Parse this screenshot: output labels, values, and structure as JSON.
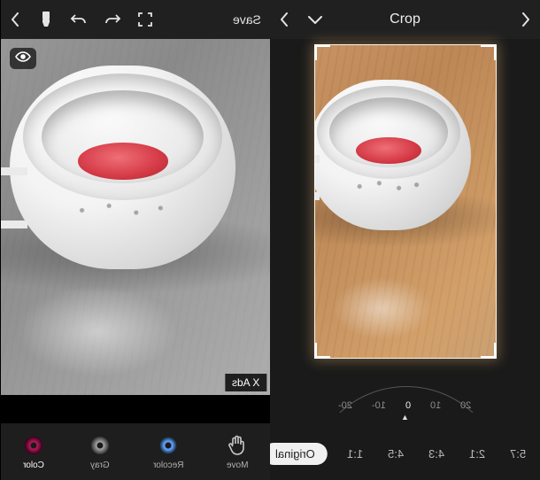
{
  "left": {
    "toolbar": {
      "save": "Save",
      "icons": {
        "fullscreen": "fullscreen-icon",
        "undo": "undo-icon",
        "redo": "redo-icon",
        "brush": "brush-icon",
        "forward": "chevron-right-icon"
      }
    },
    "overlay": {
      "ads": "X Ads",
      "eye": "eye-icon"
    },
    "tools": [
      {
        "key": "move",
        "label": "Move",
        "selected": false
      },
      {
        "key": "recolor",
        "label": "Recolor",
        "selected": false
      },
      {
        "key": "gray",
        "label": "Gray",
        "selected": false
      },
      {
        "key": "color",
        "label": "Color",
        "selected": true
      }
    ]
  },
  "right": {
    "title": "Crop",
    "toolbar": {
      "back": "chevron-left-icon",
      "dropdown": "chevron-down-icon",
      "forward": "chevron-right-icon"
    },
    "dial": {
      "ticks": [
        "20",
        "10",
        "0",
        "-10",
        "-20"
      ],
      "value": 0
    },
    "ratios": [
      {
        "label": "5:7",
        "selected": false
      },
      {
        "label": "2:1",
        "selected": false
      },
      {
        "label": "4:3",
        "selected": false
      },
      {
        "label": "4:5",
        "selected": false
      },
      {
        "label": "1:1",
        "selected": false
      },
      {
        "label": "Original",
        "selected": true
      }
    ]
  }
}
